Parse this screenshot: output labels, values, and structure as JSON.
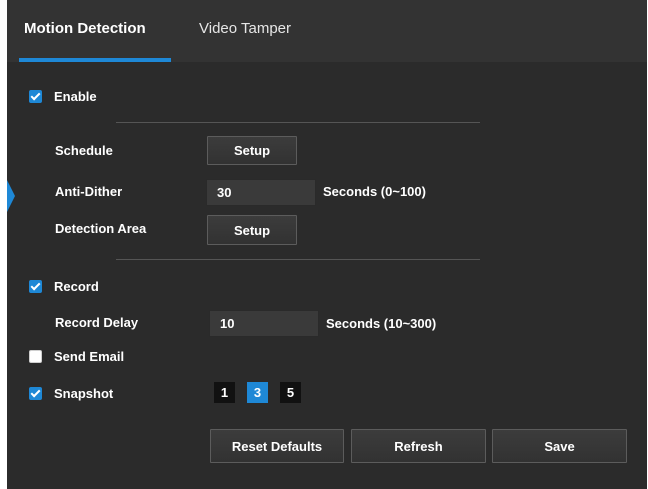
{
  "tabs": [
    {
      "label": "Motion Detection",
      "active": true
    },
    {
      "label": "Video Tamper",
      "active": false
    }
  ],
  "enable": {
    "label": "Enable",
    "checked": true
  },
  "schedule": {
    "label": "Schedule",
    "button": "Setup"
  },
  "anti_dither": {
    "label": "Anti-Dither",
    "value": "30",
    "unit": "Seconds (0~100)"
  },
  "detection_area": {
    "label": "Detection Area",
    "button": "Setup"
  },
  "record": {
    "label": "Record",
    "checked": true
  },
  "record_delay": {
    "label": "Record Delay",
    "value": "10",
    "unit": "Seconds (10~300)"
  },
  "send_email": {
    "label": "Send Email",
    "checked": false
  },
  "snapshot": {
    "label": "Snapshot",
    "checked": true,
    "options": [
      "1",
      "3",
      "5"
    ],
    "selected": "3"
  },
  "actions": {
    "reset": "Reset Defaults",
    "refresh": "Refresh",
    "save": "Save"
  },
  "colors": {
    "accent": "#1e88d6",
    "panel": "#2b2b2b",
    "header": "#333333"
  }
}
